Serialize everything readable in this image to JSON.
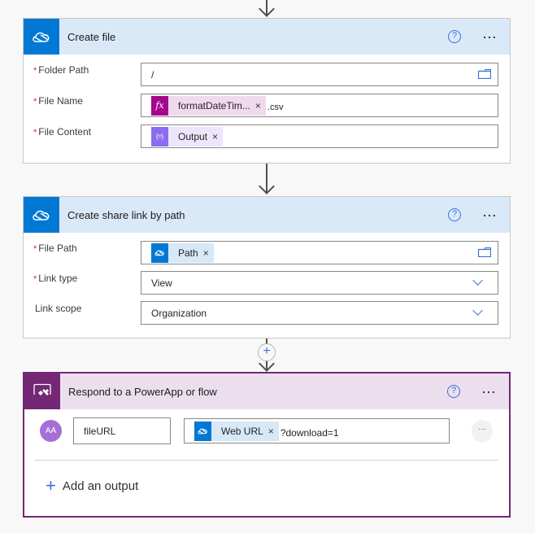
{
  "colors": {
    "onedrive_blue": "#0078d4",
    "onedrive_header_bg": "#dae9f7",
    "powerapps_purple": "#742774",
    "powerapps_header_bg": "#ebdfee",
    "expression_token_icon": "#a4068c",
    "expression_token_bg": "#f0d9ec",
    "variable_token_icon": "#8c6cf0",
    "variable_token_bg": "#ece6fd",
    "dynamic_token_bg": "#d7e8f7",
    "accent_blue": "#3b6fe0",
    "required_red": "#c0333b",
    "avatar_purple": "#a56fd6"
  },
  "create_file": {
    "title": "Create file",
    "icon": "onedrive-cloud-icon",
    "help_label": "?",
    "more_label": "...",
    "fields": [
      {
        "label": "Folder Path",
        "required_mark": "*",
        "value": "/",
        "icon": "folder-icon"
      },
      {
        "label": "File Name",
        "required_mark": "*",
        "token": {
          "icon": "fx-icon",
          "icon_text": "fx",
          "label": "formatDateTim...",
          "remove": "×"
        },
        "suffix": ".csv"
      },
      {
        "label": "File Content",
        "required_mark": "*",
        "token": {
          "icon": "variable-icon",
          "icon_text": "{▿}",
          "label": "Output",
          "remove": "×"
        }
      }
    ]
  },
  "create_share_link": {
    "title": "Create share link by path",
    "icon": "onedrive-cloud-icon",
    "help_label": "?",
    "more_label": "...",
    "fields": [
      {
        "label": "File Path",
        "required_mark": "*",
        "token": {
          "icon": "onedrive-cloud-icon",
          "label": "Path",
          "remove": "×"
        },
        "icon": "folder-icon"
      },
      {
        "label": "Link type",
        "required_mark": "*",
        "value": "View",
        "icon": "chevron-down-icon"
      },
      {
        "label": "Link scope",
        "required_mark": "",
        "value": "Organization",
        "icon": "chevron-down-icon"
      }
    ]
  },
  "insert_step": {
    "label": "+"
  },
  "respond": {
    "title": "Respond to a PowerApp or flow",
    "icon": "powerapps-icon",
    "help_label": "?",
    "more_label": "...",
    "output_row": {
      "avatar_text": "AA",
      "name": "fileURL",
      "token": {
        "icon": "onedrive-cloud-icon",
        "label": "Web URL",
        "remove": "×"
      },
      "suffix": "?download=1",
      "row_more": "···"
    },
    "add_output": {
      "icon": "+",
      "label": "Add an output"
    }
  }
}
